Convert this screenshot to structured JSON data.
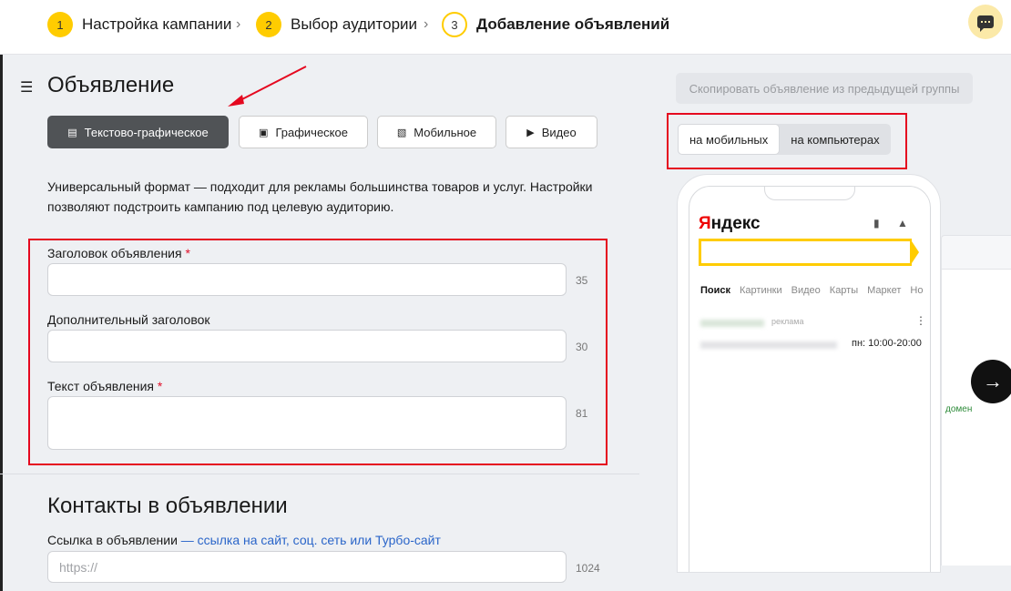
{
  "steps": [
    {
      "num": "1",
      "label": "Настройка кампании",
      "state": "done"
    },
    {
      "num": "2",
      "label": "Выбор аудитории",
      "state": "done"
    },
    {
      "num": "3",
      "label": "Добавление объявлений",
      "state": "current"
    }
  ],
  "section_title": "Объявление",
  "ad_types": [
    {
      "label": "Текстово-графическое",
      "icon": "text-image-icon",
      "active": true
    },
    {
      "label": "Графическое",
      "icon": "image-icon",
      "active": false
    },
    {
      "label": "Мобильное",
      "icon": "mobile-icon",
      "active": false
    },
    {
      "label": "Видео",
      "icon": "video-icon",
      "active": false
    }
  ],
  "description": "Универсальный формат — подходит для рекламы большинства товаров и услуг. Настройки позволяют подстроить кампанию под целевую аудиторию.",
  "fields": {
    "headline": {
      "label": "Заголовок объявления",
      "required": "*",
      "counter": "35",
      "value": ""
    },
    "subheadline": {
      "label": "Дополнительный заголовок",
      "counter": "30",
      "value": ""
    },
    "text": {
      "label": "Текст объявления",
      "required": "*",
      "counter": "81",
      "value": ""
    }
  },
  "contacts": {
    "title": "Контакты в объявлении",
    "link_label": "Ссылка в объявлении",
    "link_hint": "— ссылка на сайт, соц. сеть или Турбо-сайт",
    "url_placeholder": "https://",
    "url_counter": "1024"
  },
  "preview": {
    "copy_button": "Скопировать объявление из предыдущей группы",
    "toggle": [
      "на мобильных",
      "на компьютерах"
    ],
    "active_toggle": 0,
    "logo_first": "Я",
    "logo_rest": "ндекс",
    "tabs": [
      "Поиск",
      "Картинки",
      "Видео",
      "Карты",
      "Маркет",
      "Но"
    ],
    "ad_label": "реклама",
    "hours": "пн: 10:00-20:00",
    "desktop_domain": "домен"
  },
  "colors": {
    "accent": "#ffcc00",
    "annotation_red": "#e5081f",
    "link": "#2a65c9"
  }
}
